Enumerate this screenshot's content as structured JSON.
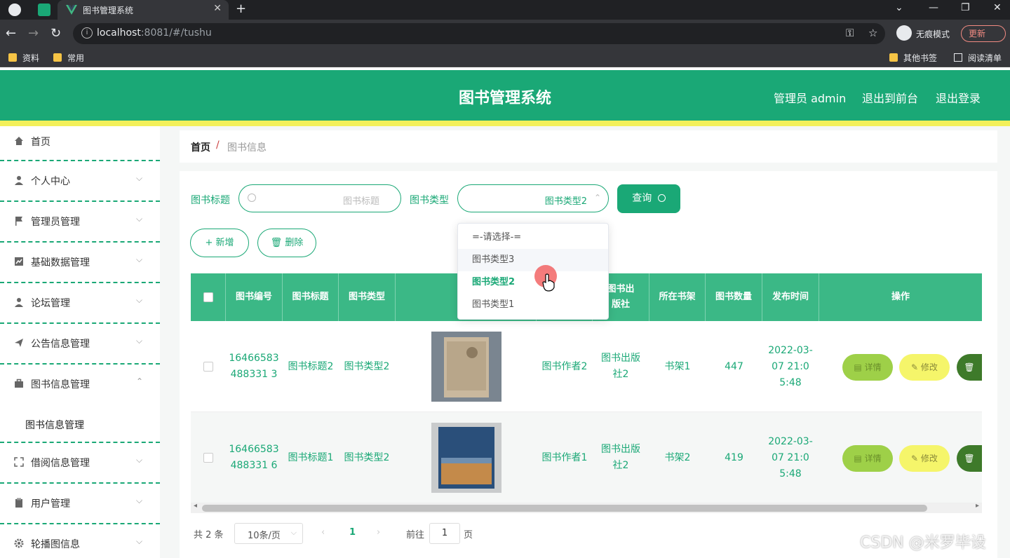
{
  "browser": {
    "tab_title": "图书管理系统",
    "url_host": "localhost",
    "url_path": ":8081/#/tushu",
    "incognito_label": "无痕模式",
    "update_label": "更新",
    "bookmarks": [
      "资料",
      "常用"
    ],
    "bookmarks_right": [
      "其他书签",
      "阅读清单"
    ]
  },
  "header": {
    "title": "图书管理系统",
    "user": "管理员 admin",
    "to_front": "退出到前台",
    "logout": "退出登录"
  },
  "sidebar": {
    "items": [
      {
        "label": "首页"
      },
      {
        "label": "个人中心"
      },
      {
        "label": "管理员管理"
      },
      {
        "label": "基础数据管理"
      },
      {
        "label": "论坛管理"
      },
      {
        "label": "公告信息管理"
      },
      {
        "label": "图书信息管理"
      },
      {
        "label": "借阅信息管理"
      },
      {
        "label": "用户管理"
      },
      {
        "label": "轮播图信息"
      }
    ],
    "sub_active": "图书信息管理"
  },
  "breadcrumb": {
    "home": "首页",
    "sep": "/",
    "current": "图书信息"
  },
  "search": {
    "title_label": "图书标题",
    "title_placeholder": "图书标题",
    "type_label": "图书类型",
    "type_value": "图书类型2",
    "query_label": "查询"
  },
  "actions": {
    "add_label": "新增",
    "delete_label": "删除"
  },
  "dropdown": {
    "options": [
      "=-请选择-=",
      "图书类型3",
      "图书类型2",
      "图书类型1"
    ],
    "selected": "图书类型2"
  },
  "table": {
    "headers": [
      "图书编号",
      "图书标题",
      "图书类型",
      "图",
      "图书出版社",
      "所在书架",
      "图书数量",
      "发布时间",
      "操作"
    ],
    "rows": [
      {
        "id": "16466583488331 3",
        "title": "图书标题2",
        "type": "图书类型2",
        "author": "图书作者2",
        "publisher": "图书出版社2",
        "shelf": "书架1",
        "count": "447",
        "time": "2022-03-07 21:05:48"
      },
      {
        "id": "16466583488331 6",
        "title": "图书标题1",
        "type": "图书类型2",
        "author": "图书作者1",
        "publisher": "图书出版社2",
        "shelf": "书架2",
        "count": "419",
        "time": "2022-03-07 21:05:48"
      }
    ],
    "row_actions": {
      "detail": "详情",
      "edit": "修改"
    }
  },
  "pagination": {
    "total": "共 2 条",
    "page_size": "10条/页",
    "current_page": "1",
    "goto_label": "前往",
    "goto_value": "1",
    "page_suffix": "页"
  },
  "watermark": "CSDN @米罗毕设",
  "colors": {
    "accent": "#1aa876",
    "yellow": "#f3f05a"
  }
}
